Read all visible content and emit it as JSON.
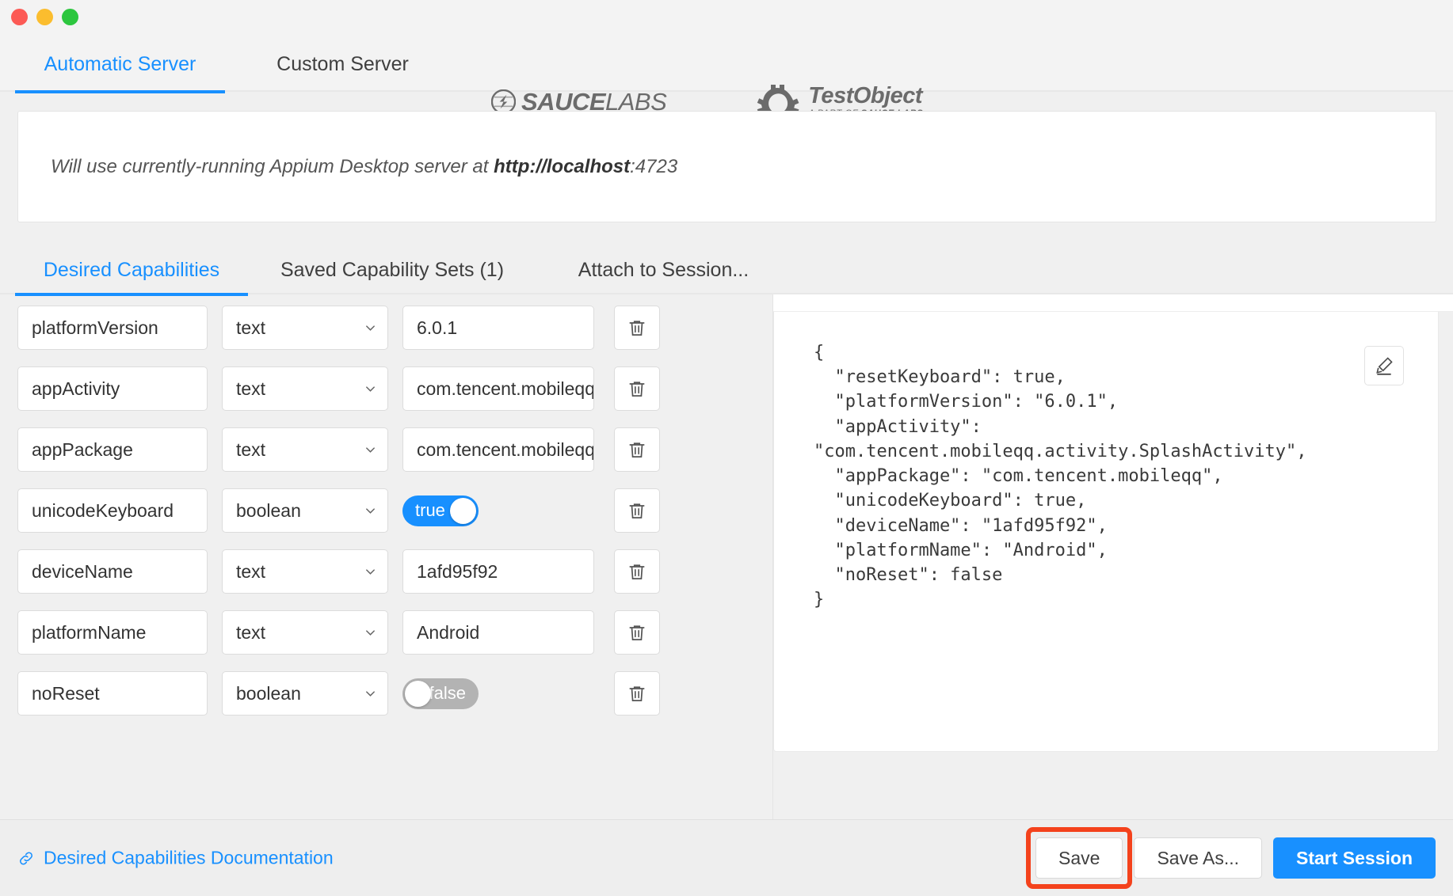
{
  "window": {
    "traffic_lights": [
      {
        "name": "close",
        "color": "#fc5a55"
      },
      {
        "name": "minimize",
        "color": "#fbbd2e"
      },
      {
        "name": "maximize",
        "color": "#2cc63e"
      }
    ]
  },
  "server_tabs": [
    {
      "label": "Automatic Server",
      "active": true
    },
    {
      "label": "Custom Server",
      "active": false
    }
  ],
  "logos": {
    "saucelabs": {
      "bold": "SAUCE",
      "light": "LABS"
    },
    "testobject": {
      "name": "TestObject",
      "sub_prefix": "A PART OF ",
      "sub_bold": "SAUCE LABS"
    }
  },
  "banner": {
    "prefix": "Will use currently-running Appium Desktop server at ",
    "host": "http://localhost",
    "port": ":4723"
  },
  "cap_tabs": [
    {
      "label": "Desired Capabilities",
      "active": true
    },
    {
      "label": "Saved Capability Sets (1)",
      "active": false
    },
    {
      "label": "Attach to Session...",
      "active": false
    }
  ],
  "capabilities": [
    {
      "name": "platformVersion",
      "type": "text",
      "value": "6.0.1",
      "kind": "text"
    },
    {
      "name": "appActivity",
      "type": "text",
      "value": "com.tencent.mobileqq",
      "kind": "text"
    },
    {
      "name": "appPackage",
      "type": "text",
      "value": "com.tencent.mobileqq",
      "kind": "text"
    },
    {
      "name": "unicodeKeyboard",
      "type": "boolean",
      "value": "true",
      "kind": "boolean",
      "on": true
    },
    {
      "name": "deviceName",
      "type": "text",
      "value": "1afd95f92",
      "kind": "text"
    },
    {
      "name": "platformName",
      "type": "text",
      "value": "Android",
      "kind": "text"
    },
    {
      "name": "noReset",
      "type": "boolean",
      "value": "false",
      "kind": "boolean",
      "on": false
    }
  ],
  "json_preview": {
    "text": "{\n  \"resetKeyboard\": true,\n  \"platformVersion\": \"6.0.1\",\n  \"appActivity\":\n\"com.tencent.mobileqq.activity.SplashActivity\",\n  \"appPackage\": \"com.tencent.mobileqq\",\n  \"unicodeKeyboard\": true,\n  \"deviceName\": \"1afd95f92\",\n  \"platformName\": \"Android\",\n  \"noReset\": false\n}"
  },
  "footer": {
    "doc_link": "Desired Capabilities Documentation",
    "save": "Save",
    "save_as": "Save As...",
    "start_session": "Start Session"
  },
  "colors": {
    "accent": "#1890ff",
    "highlight": "#f4421c",
    "toggle_off": "#b3b3b3"
  }
}
